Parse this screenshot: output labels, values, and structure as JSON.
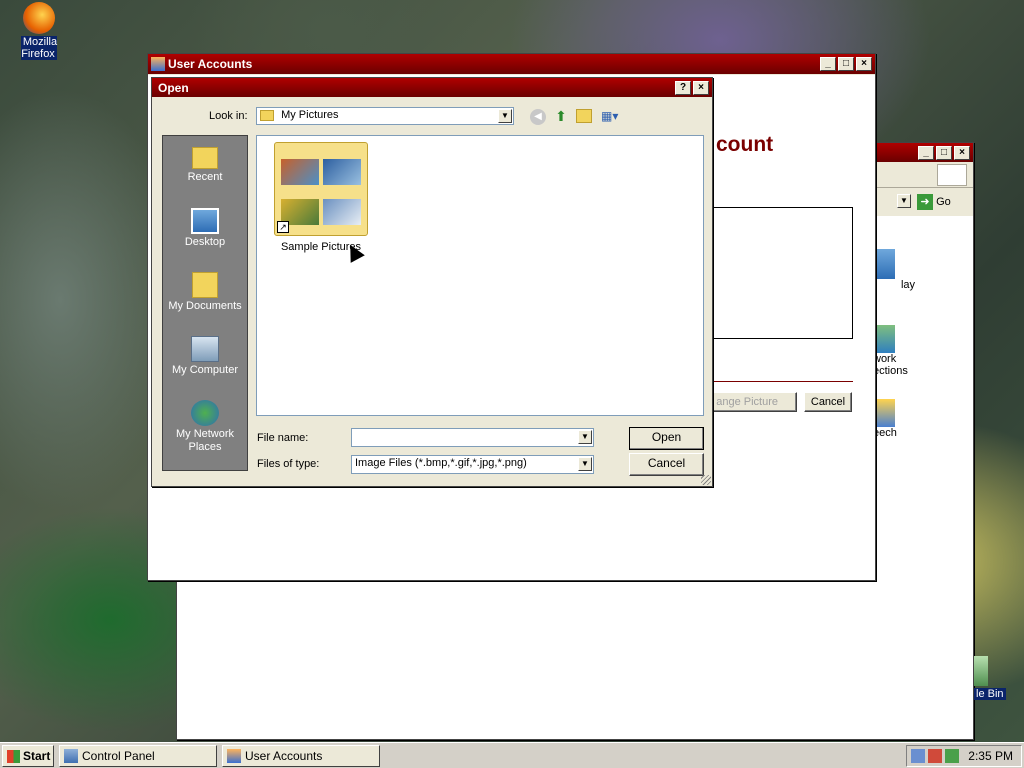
{
  "desktop": {
    "icons": [
      {
        "label": "Mozilla Firefox"
      }
    ],
    "partial_right_labels": [
      "lay",
      "work",
      "ections",
      "eech",
      "le Bin"
    ]
  },
  "user_accounts": {
    "title": "User Accounts",
    "heading_partial": "count",
    "change_picture_label": "ange Picture",
    "cancel_label": "Cancel"
  },
  "control_panel_back": {
    "go_label": "Go"
  },
  "open_dialog": {
    "title": "Open",
    "look_in_label": "Look in:",
    "look_in_value": "My Pictures",
    "places": [
      {
        "label": "Recent",
        "icon": "folder-icon"
      },
      {
        "label": "Desktop",
        "icon": "desktop-icon"
      },
      {
        "label": "My Documents",
        "icon": "my-documents-icon"
      },
      {
        "label": "My Computer",
        "icon": "my-computer-icon"
      },
      {
        "label": "My Network Places",
        "icon": "network-icon"
      }
    ],
    "files": [
      {
        "label": "Sample Pictures"
      }
    ],
    "file_name_label": "File name:",
    "file_name_value": "",
    "files_of_type_label": "Files of type:",
    "files_of_type_value": "Image Files (*.bmp,*.gif,*.jpg,*.png)",
    "open_button": "Open",
    "cancel_button": "Cancel"
  },
  "taskbar": {
    "start_label": "Start",
    "items": [
      {
        "label": "Control Panel"
      },
      {
        "label": "User Accounts"
      }
    ],
    "clock": "2:35 PM"
  }
}
